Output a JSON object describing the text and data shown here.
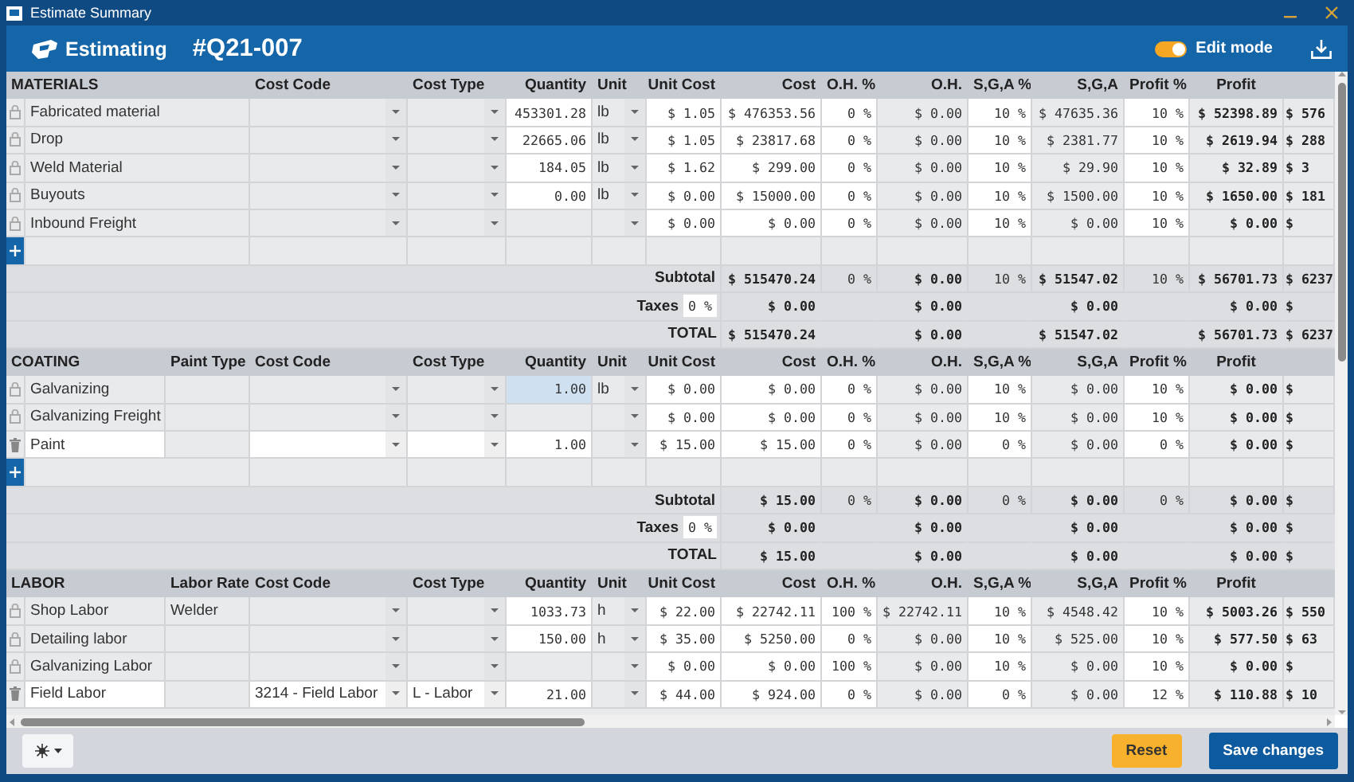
{
  "window": {
    "title": "Estimate Summary"
  },
  "header": {
    "app_name": "Estimating",
    "quote_number": "#Q21-007",
    "edit_mode": {
      "label": "Edit mode",
      "on": true
    }
  },
  "sections": [
    {
      "title": "MATERIALS",
      "columns": [
        "Cost Code",
        "Cost Type",
        "Quantity",
        "Unit",
        "Unit Cost",
        "Cost",
        "O.H. %",
        "O.H.",
        "S,G,A %",
        "S,G,A",
        "Profit %",
        "Profit"
      ],
      "rows": [
        {
          "kind": "locked",
          "name": "Fabricated material",
          "quantity": "453301.28",
          "quantity_focused": false,
          "unit": "lb",
          "unit_cost": "$ 1.05",
          "cost": "$ 476353.56",
          "oh_pct": "0 %",
          "oh": "$ 0.00",
          "sga_pct": "10 %",
          "sga": "$ 47635.36",
          "profit_pct": "10 %",
          "profit": "$ 52398.89",
          "column_15": "$ 576"
        },
        {
          "kind": "locked",
          "name": "Drop",
          "quantity": "22665.06",
          "quantity_focused": false,
          "unit": "lb",
          "unit_cost": "$ 1.05",
          "cost": "$ 23817.68",
          "oh_pct": "0 %",
          "oh": "$ 0.00",
          "sga_pct": "10 %",
          "sga": "$ 2381.77",
          "profit_pct": "10 %",
          "profit": "$ 2619.94",
          "column_15": "$ 288"
        },
        {
          "kind": "locked",
          "name": "Weld Material",
          "quantity": "184.05",
          "quantity_focused": false,
          "unit": "lb",
          "unit_cost": "$ 1.62",
          "cost": "$ 299.00",
          "oh_pct": "0 %",
          "oh": "$ 0.00",
          "sga_pct": "10 %",
          "sga": "$ 29.90",
          "profit_pct": "10 %",
          "profit": "$ 32.89",
          "column_15": "$ 3"
        },
        {
          "kind": "locked",
          "name": "Buyouts",
          "quantity": "0.00",
          "quantity_focused": false,
          "unit": "lb",
          "unit_cost": "$ 0.00",
          "cost": "$ 15000.00",
          "oh_pct": "0 %",
          "oh": "$ 0.00",
          "sga_pct": "10 %",
          "sga": "$ 1500.00",
          "profit_pct": "10 %",
          "profit": "$ 1650.00",
          "column_15": "$ 181"
        },
        {
          "kind": "locked",
          "name": "Inbound Freight",
          "quantity_focused": false,
          "unit_cost": "$ 0.00",
          "cost": "$ 0.00",
          "oh_pct": "0 %",
          "oh": "$ 0.00",
          "sga_pct": "10 %",
          "sga": "$ 0.00",
          "profit_pct": "10 %",
          "profit": "$ 0.00",
          "column_15": "$"
        }
      ],
      "subtotal": {
        "label": "Subtotal",
        "cost": "$ 515470.24",
        "oh_pct": "0 %",
        "oh": "$ 0.00",
        "sga_pct": "10 %",
        "sga": "$ 51547.02",
        "profit_pct": "10 %",
        "profit": "$ 56701.73",
        "column_15": "$ 6237"
      },
      "taxes": {
        "label": "Taxes",
        "rate": "0 %",
        "cost": "$ 0.00",
        "oh": "$ 0.00",
        "sga": "$ 0.00",
        "profit": "$ 0.00",
        "column_15": "$"
      },
      "total": {
        "label": "TOTAL",
        "cost": "$ 515470.24",
        "oh": "$ 0.00",
        "sga": "$ 51547.02",
        "profit": "$ 56701.73",
        "column_15": "$ 6237"
      }
    },
    {
      "title": "COATING",
      "extra_column": "Paint Type",
      "columns": [
        "Cost Code",
        "Cost Type",
        "Quantity",
        "Unit",
        "Unit Cost",
        "Cost",
        "O.H. %",
        "O.H.",
        "S,G,A %",
        "S,G,A",
        "Profit %",
        "Profit"
      ],
      "rows": [
        {
          "kind": "locked",
          "name": "Galvanizing",
          "quantity": "1.00",
          "quantity_focused": true,
          "unit": "lb",
          "unit_cost": "$ 0.00",
          "cost": "$ 0.00",
          "oh_pct": "0 %",
          "oh": "$ 0.00",
          "sga_pct": "10 %",
          "sga": "$ 0.00",
          "profit_pct": "10 %",
          "profit": "$ 0.00",
          "column_15": "$"
        },
        {
          "kind": "locked",
          "name": "Galvanizing Freight",
          "quantity_focused": false,
          "unit_cost": "$ 0.00",
          "cost": "$ 0.00",
          "oh_pct": "0 %",
          "oh": "$ 0.00",
          "sga_pct": "10 %",
          "sga": "$ 0.00",
          "profit_pct": "10 %",
          "profit": "$ 0.00",
          "column_15": "$"
        },
        {
          "kind": "custom",
          "name": "Paint",
          "quantity": "1.00",
          "quantity_focused": false,
          "unit_cost": "$ 15.00",
          "cost": "$ 15.00",
          "oh_pct": "0 %",
          "oh": "$ 0.00",
          "sga_pct": "0 %",
          "sga": "$ 0.00",
          "profit_pct": "0 %",
          "profit": "$ 0.00",
          "column_15": "$"
        }
      ],
      "subtotal": {
        "label": "Subtotal",
        "cost": "$ 15.00",
        "oh_pct": "0 %",
        "oh": "$ 0.00",
        "sga_pct": "0 %",
        "sga": "$ 0.00",
        "profit_pct": "0 %",
        "profit": "$ 0.00",
        "column_15": "$"
      },
      "taxes": {
        "label": "Taxes",
        "rate": "0 %",
        "cost": "$ 0.00",
        "oh": "$ 0.00",
        "sga": "$ 0.00",
        "profit": "$ 0.00",
        "column_15": "$"
      },
      "total": {
        "label": "TOTAL",
        "cost": "$ 15.00",
        "oh": "$ 0.00",
        "sga": "$ 0.00",
        "profit": "$ 0.00",
        "column_15": "$"
      }
    },
    {
      "title": "LABOR",
      "extra_column": "Labor Rate",
      "columns": [
        "Cost Code",
        "Cost Type",
        "Quantity",
        "Unit",
        "Unit Cost",
        "Cost",
        "O.H. %",
        "O.H.",
        "S,G,A %",
        "S,G,A",
        "Profit %",
        "Profit"
      ],
      "rows": [
        {
          "kind": "locked",
          "name": "Shop Labor",
          "labor_rate": "Welder",
          "quantity": "1033.73",
          "quantity_focused": false,
          "unit": "h",
          "unit_cost": "$ 22.00",
          "cost": "$ 22742.11",
          "oh_pct": "100 %",
          "oh": "$ 22742.11",
          "sga_pct": "10 %",
          "sga": "$ 4548.42",
          "profit_pct": "10 %",
          "profit": "$ 5003.26",
          "column_15": "$ 550"
        },
        {
          "kind": "locked",
          "name": "Detailing labor",
          "quantity": "150.00",
          "quantity_focused": false,
          "unit": "h",
          "unit_cost": "$ 35.00",
          "cost": "$ 5250.00",
          "oh_pct": "0 %",
          "oh": "$ 0.00",
          "sga_pct": "10 %",
          "sga": "$ 525.00",
          "profit_pct": "10 %",
          "profit": "$ 577.50",
          "column_15": "$ 63"
        },
        {
          "kind": "locked",
          "name": "Galvanizing Labor",
          "quantity_focused": false,
          "unit_cost": "$ 0.00",
          "cost": "$ 0.00",
          "oh_pct": "100 %",
          "oh": "$ 0.00",
          "sga_pct": "10 %",
          "sga": "$ 0.00",
          "profit_pct": "10 %",
          "profit": "$ 0.00",
          "column_15": "$"
        },
        {
          "kind": "custom",
          "name": "Field Labor",
          "cost_code": "3214 - Field Labor",
          "cost_type": "L - Labor",
          "quantity": "21.00",
          "quantity_focused": false,
          "unit_cost": "$ 44.00",
          "cost": "$ 924.00",
          "oh_pct": "0 %",
          "oh": "$ 0.00",
          "sga_pct": "0 %",
          "sga": "$ 0.00",
          "profit_pct": "12 %",
          "profit": "$ 110.88",
          "column_15": "$ 10"
        }
      ]
    }
  ],
  "footer": {
    "reset": "Reset",
    "save": "Save changes"
  }
}
